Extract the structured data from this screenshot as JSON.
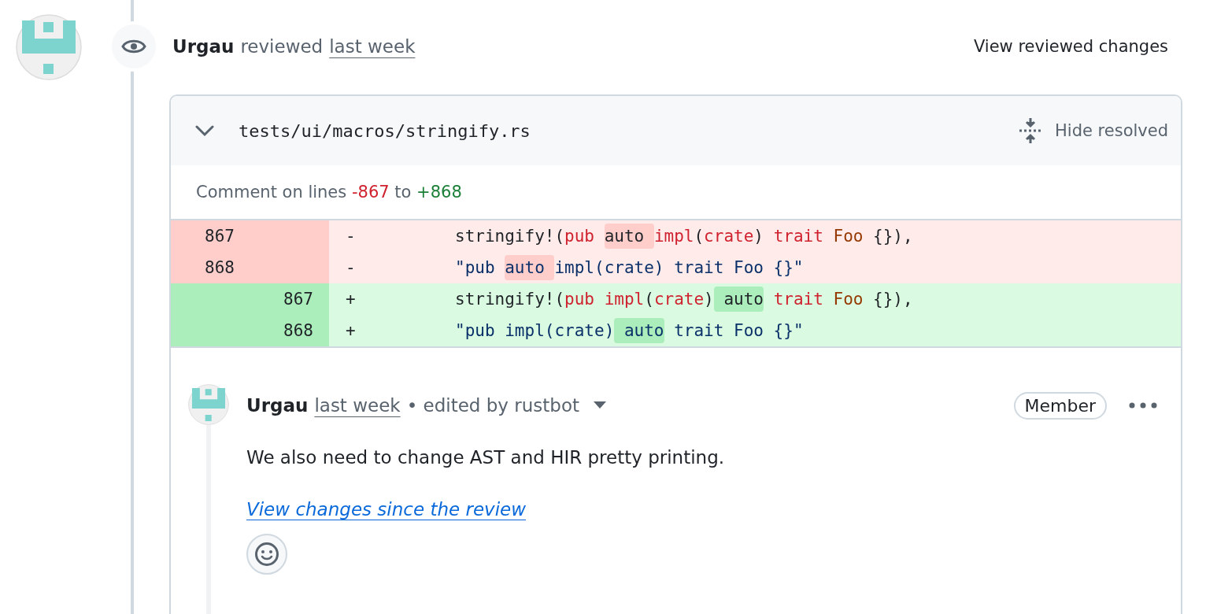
{
  "review": {
    "author": "Urgau",
    "action": "reviewed",
    "time": "last week",
    "view_button": "View reviewed changes"
  },
  "file": {
    "path": "tests/ui/macros/stringify.rs",
    "expanded": true,
    "hide_resolved": "Hide resolved",
    "comment_range": {
      "prefix": "Comment on lines",
      "from": "-867",
      "joiner": "to",
      "to": "+868"
    },
    "lines": [
      {
        "kind": "deletion",
        "old": "867",
        "sign": "-",
        "tokens": [
          {
            "t": "stringify!(",
            "kind": "plain",
            "hl": false
          },
          {
            "t": "pub ",
            "kind": "keyword",
            "hl": false
          },
          {
            "t": "auto ",
            "kind": "plain",
            "hl": true
          },
          {
            "t": "impl",
            "kind": "keyword",
            "hl": false
          },
          {
            "t": "(",
            "kind": "plain",
            "hl": false
          },
          {
            "t": "crate",
            "kind": "keyword",
            "hl": false
          },
          {
            "t": ") ",
            "kind": "plain",
            "hl": false
          },
          {
            "t": "trait ",
            "kind": "keyword",
            "hl": false
          },
          {
            "t": "Foo",
            "kind": "type",
            "hl": false
          },
          {
            "t": " {}),",
            "kind": "plain",
            "hl": false
          }
        ]
      },
      {
        "kind": "deletion",
        "old": "868",
        "sign": "-",
        "tokens": [
          {
            "t": "\"pub ",
            "kind": "string",
            "hl": false
          },
          {
            "t": "auto ",
            "kind": "string",
            "hl": true
          },
          {
            "t": "impl(crate) trait Foo {}\"",
            "kind": "string",
            "hl": false
          }
        ]
      },
      {
        "kind": "addition",
        "new": "867",
        "sign": "+",
        "tokens": [
          {
            "t": "stringify!(",
            "kind": "plain",
            "hl": false
          },
          {
            "t": "pub ",
            "kind": "keyword",
            "hl": false
          },
          {
            "t": "impl",
            "kind": "keyword",
            "hl": false
          },
          {
            "t": "(",
            "kind": "plain",
            "hl": false
          },
          {
            "t": "crate",
            "kind": "keyword",
            "hl": false
          },
          {
            "t": ")",
            "kind": "plain",
            "hl": false
          },
          {
            "t": " auto",
            "kind": "plain",
            "hl": true
          },
          {
            "t": " trait ",
            "kind": "keyword",
            "hl": false
          },
          {
            "t": "Foo",
            "kind": "type",
            "hl": false
          },
          {
            "t": " {}),",
            "kind": "plain",
            "hl": false
          }
        ]
      },
      {
        "kind": "addition",
        "new": "868",
        "sign": "+",
        "tokens": [
          {
            "t": "\"pub impl(crate)",
            "kind": "string",
            "hl": false
          },
          {
            "t": " auto",
            "kind": "string",
            "hl": true
          },
          {
            "t": " trait Foo {}\"",
            "kind": "string",
            "hl": false
          }
        ]
      }
    ]
  },
  "comment": {
    "author": "Urgau",
    "time": "last week",
    "edited": "• edited by rustbot",
    "badge": "Member",
    "body": "We also need to change AST and HIR pretty printing.",
    "link": "View changes since the review"
  }
}
